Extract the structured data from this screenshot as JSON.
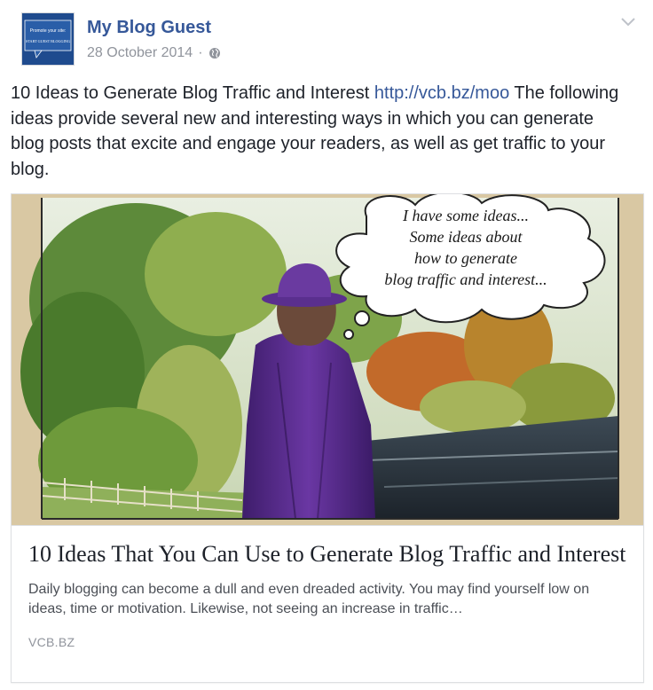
{
  "post": {
    "author": "My Blog Guest",
    "date": "28 October 2014",
    "separator": "·",
    "privacy_icon": "globe-icon",
    "menu_icon": "chevron-down-icon",
    "avatar": {
      "line1": "Promote your site:",
      "line2": "START GUEST BLOGGING"
    },
    "text_before_link": "10 Ideas to Generate Blog Traffic and Interest ",
    "link": "http://vcb.bz/moo",
    "text_after_link": " The following ideas provide several new and interesting ways in which you can generate blog posts that excite and engage your readers, as well as get traffic to your blog."
  },
  "card": {
    "bubble_lines": [
      "I have some ideas...",
      "Some ideas about",
      "how to generate",
      "blog traffic and interest..."
    ],
    "title": "10 Ideas That You Can Use to Generate Blog Traffic and Interest",
    "description": "Daily blogging can become a dull and even dreaded activity. You may find yourself low on ideas, time or motivation. Likewise, not seeing an increase in traffic…",
    "domain": "VCB.BZ"
  },
  "colors": {
    "link": "#365899",
    "meta": "#90949c",
    "text": "#1d2129",
    "purple_coat": "#5b2d8e"
  }
}
